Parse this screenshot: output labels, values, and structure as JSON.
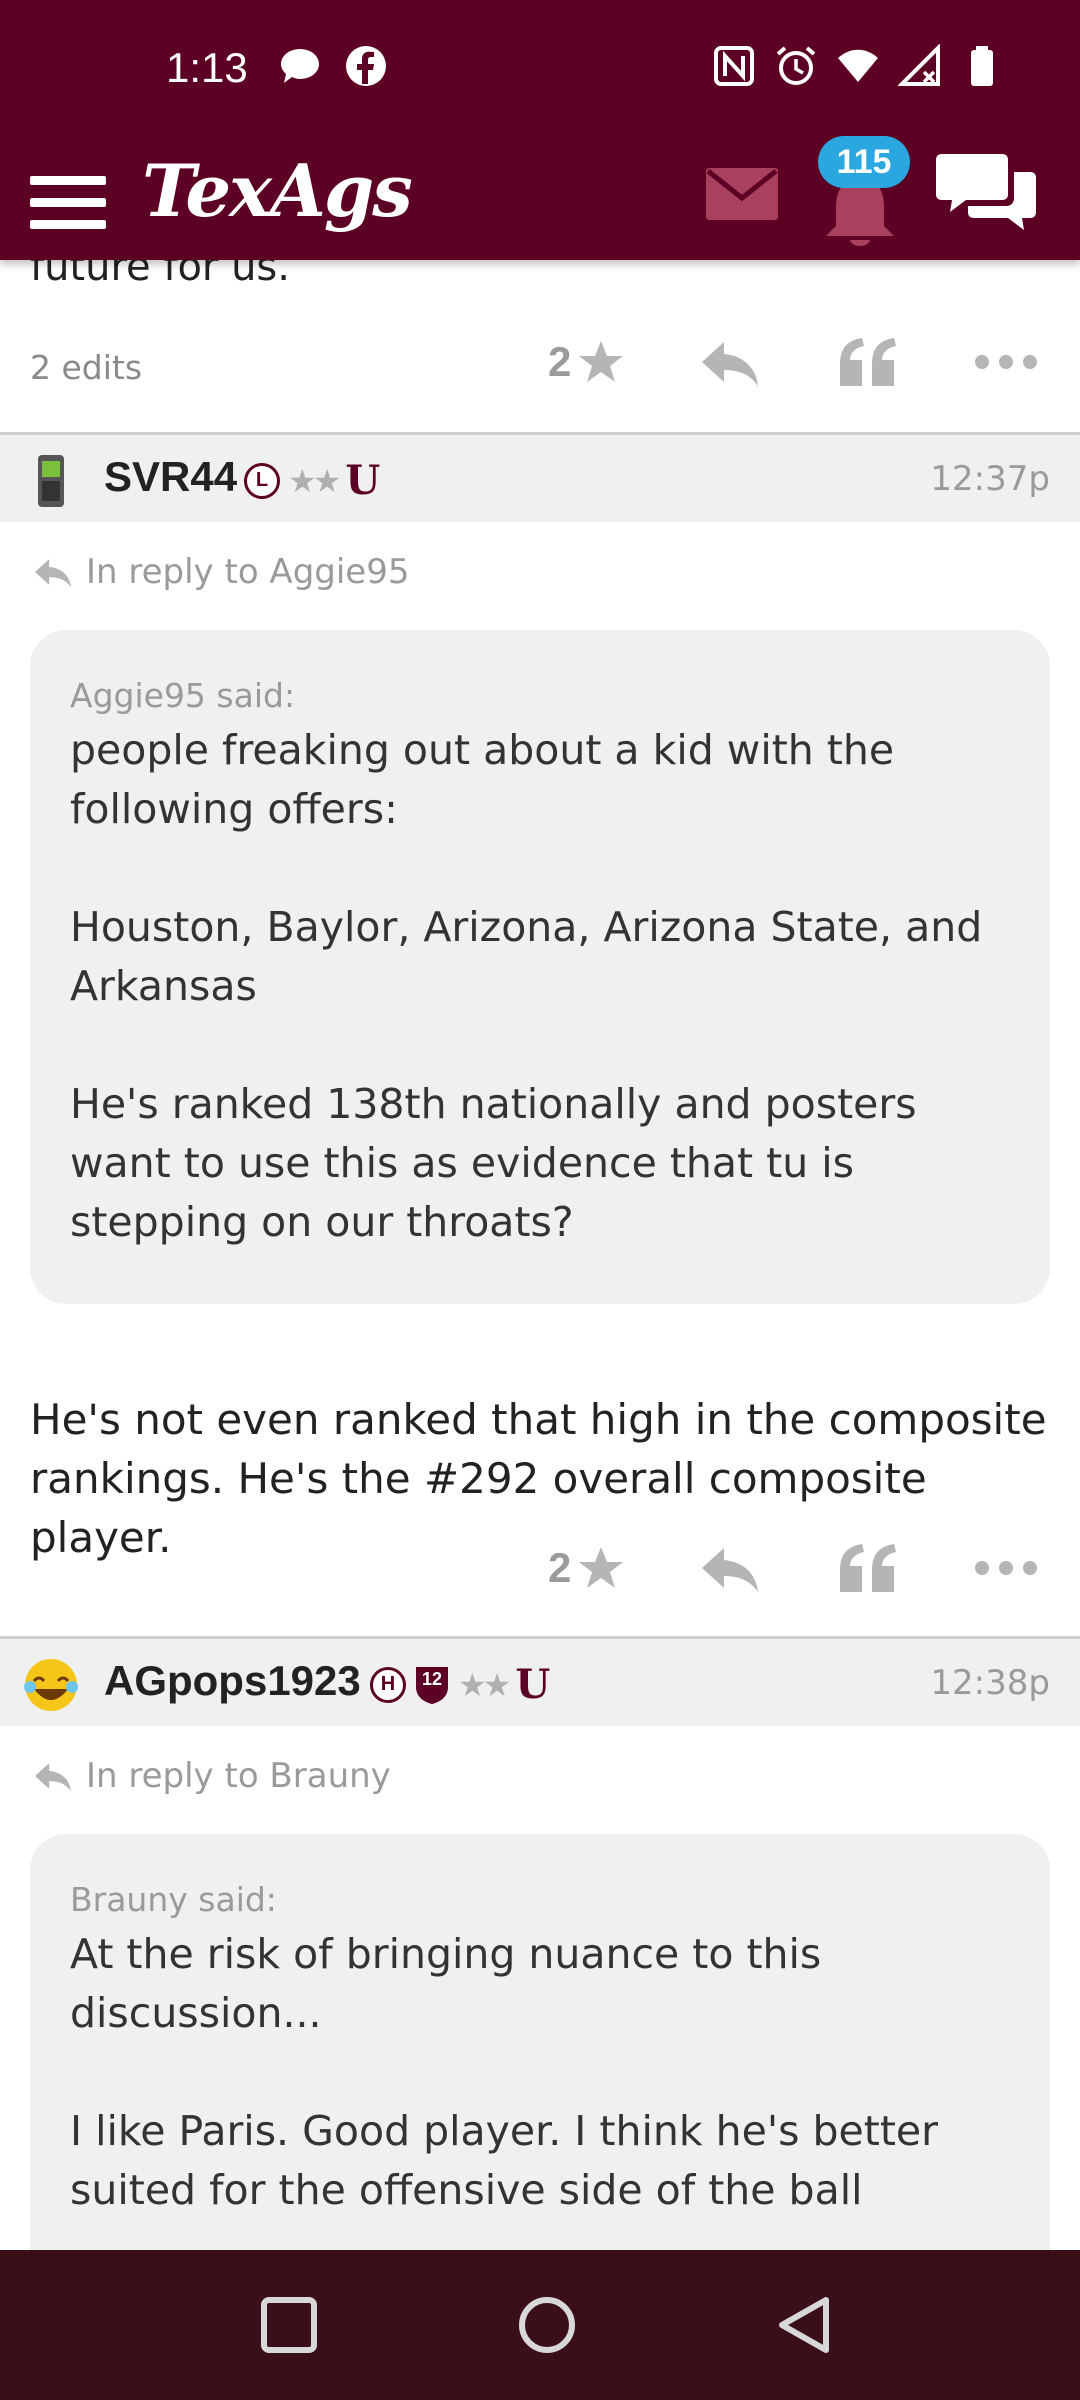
{
  "status_bar": {
    "time": "1:13",
    "left_icons": [
      "chat-bubble-icon",
      "facebook-icon"
    ],
    "right_icons": [
      "nfc-icon",
      "alarm-icon",
      "wifi-icon",
      "signal-icon",
      "battery-icon"
    ]
  },
  "header": {
    "logo": "TexAgs",
    "notification_count": "115",
    "colors": {
      "maroon": "#5c0024",
      "badge_blue": "#2ba7e0"
    }
  },
  "posts": [
    {
      "clipped_text": "future for us.",
      "edits": "2 edits",
      "star_count": "2"
    },
    {
      "username": "SVR44",
      "badges": [
        "L",
        "★★",
        "U"
      ],
      "time": "12:37p",
      "reply_to": "In reply to Aggie95",
      "quote": {
        "author": "Aggie95 said:",
        "paragraphs": [
          "people freaking out about a kid with the following offers:",
          "Houston, Baylor, Arizona, Arizona State, and Arkansas",
          "He's ranked 138th nationally and posters want to use this as evidence that tu is stepping on our throats?"
        ]
      },
      "body": "He's not even ranked that high in the composite rankings. He's the #292 overall composite player.",
      "star_count": "2"
    },
    {
      "username": "AGpops1923",
      "badges": [
        "H",
        "12",
        "★★",
        "U"
      ],
      "time": "12:38p",
      "reply_to": "In reply to Brauny",
      "quote": {
        "author": "Brauny said:",
        "paragraphs": [
          "At the risk of bringing nuance to this discussion...",
          "I like Paris. Good player. I think he's better suited for the offensive side of the ball"
        ]
      }
    }
  ],
  "nav": [
    "recents-button",
    "home-button",
    "back-button"
  ]
}
